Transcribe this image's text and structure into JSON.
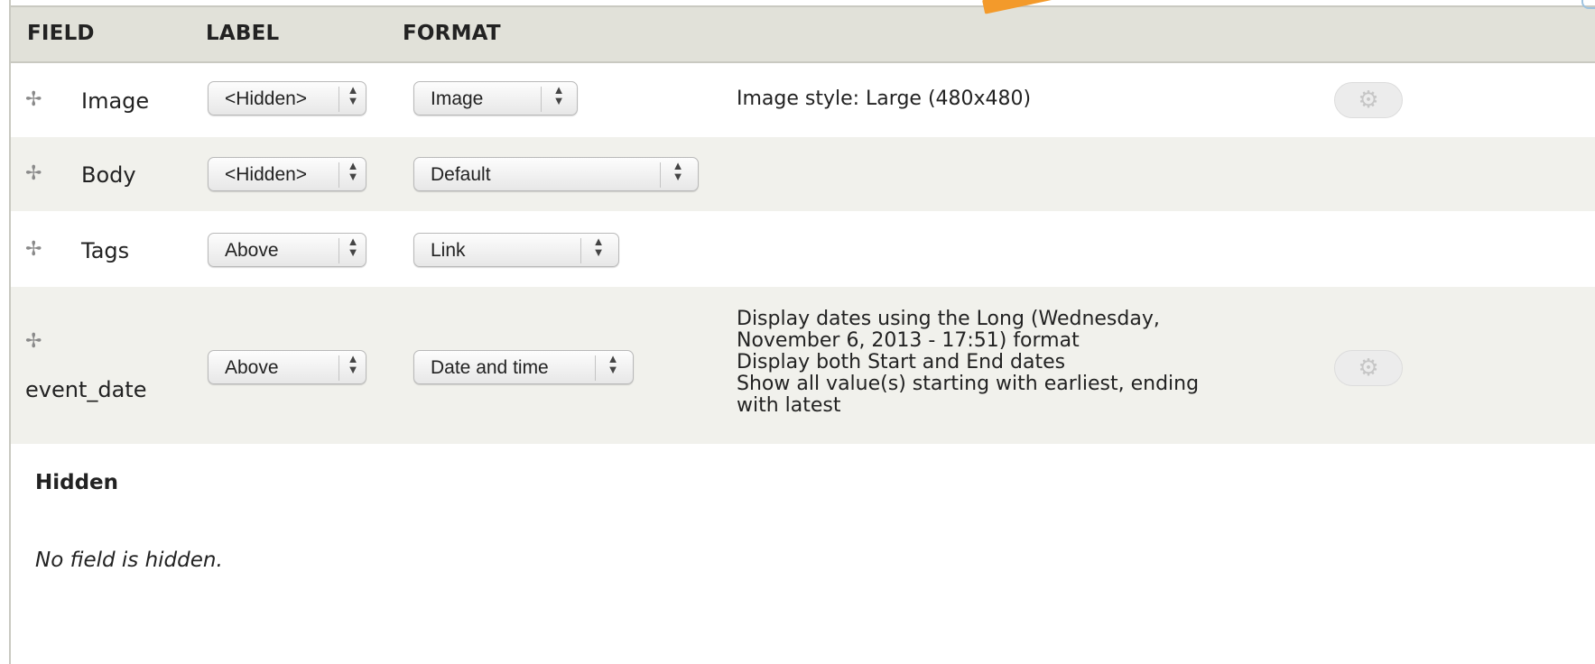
{
  "table": {
    "columns": [
      "FIELD",
      "LABEL",
      "FORMAT"
    ],
    "rows": [
      {
        "field": "Image",
        "label": "<Hidden>",
        "format": "Image",
        "summary": [
          "Image style: Large (480x480)"
        ],
        "has_settings": true
      },
      {
        "field": "Body",
        "label": "<Hidden>",
        "format": "Default",
        "summary": [],
        "has_settings": false
      },
      {
        "field": "Tags",
        "label": "Above",
        "format": "Link",
        "summary": [],
        "has_settings": false
      },
      {
        "field": "event_date",
        "label": "Above",
        "format": "Date and time",
        "summary": [
          "Display dates using the Long (Wednesday,",
          "November 6, 2013 - 17:51) format",
          "Display both Start and End dates",
          "Show all value(s) starting with earliest, ending",
          "with latest"
        ],
        "has_settings": true
      }
    ]
  },
  "hidden_section": {
    "title": "Hidden",
    "empty_text": "No field is hidden."
  },
  "icons": {
    "drag": "drag-handle-icon",
    "settings": "gear-icon",
    "select_arrows": "up-down-arrows-icon"
  },
  "colors": {
    "header_bg": "#e1e1d9",
    "stripe_bg": "#f1f1ec",
    "annotation_arrow": "#f39a2b"
  }
}
